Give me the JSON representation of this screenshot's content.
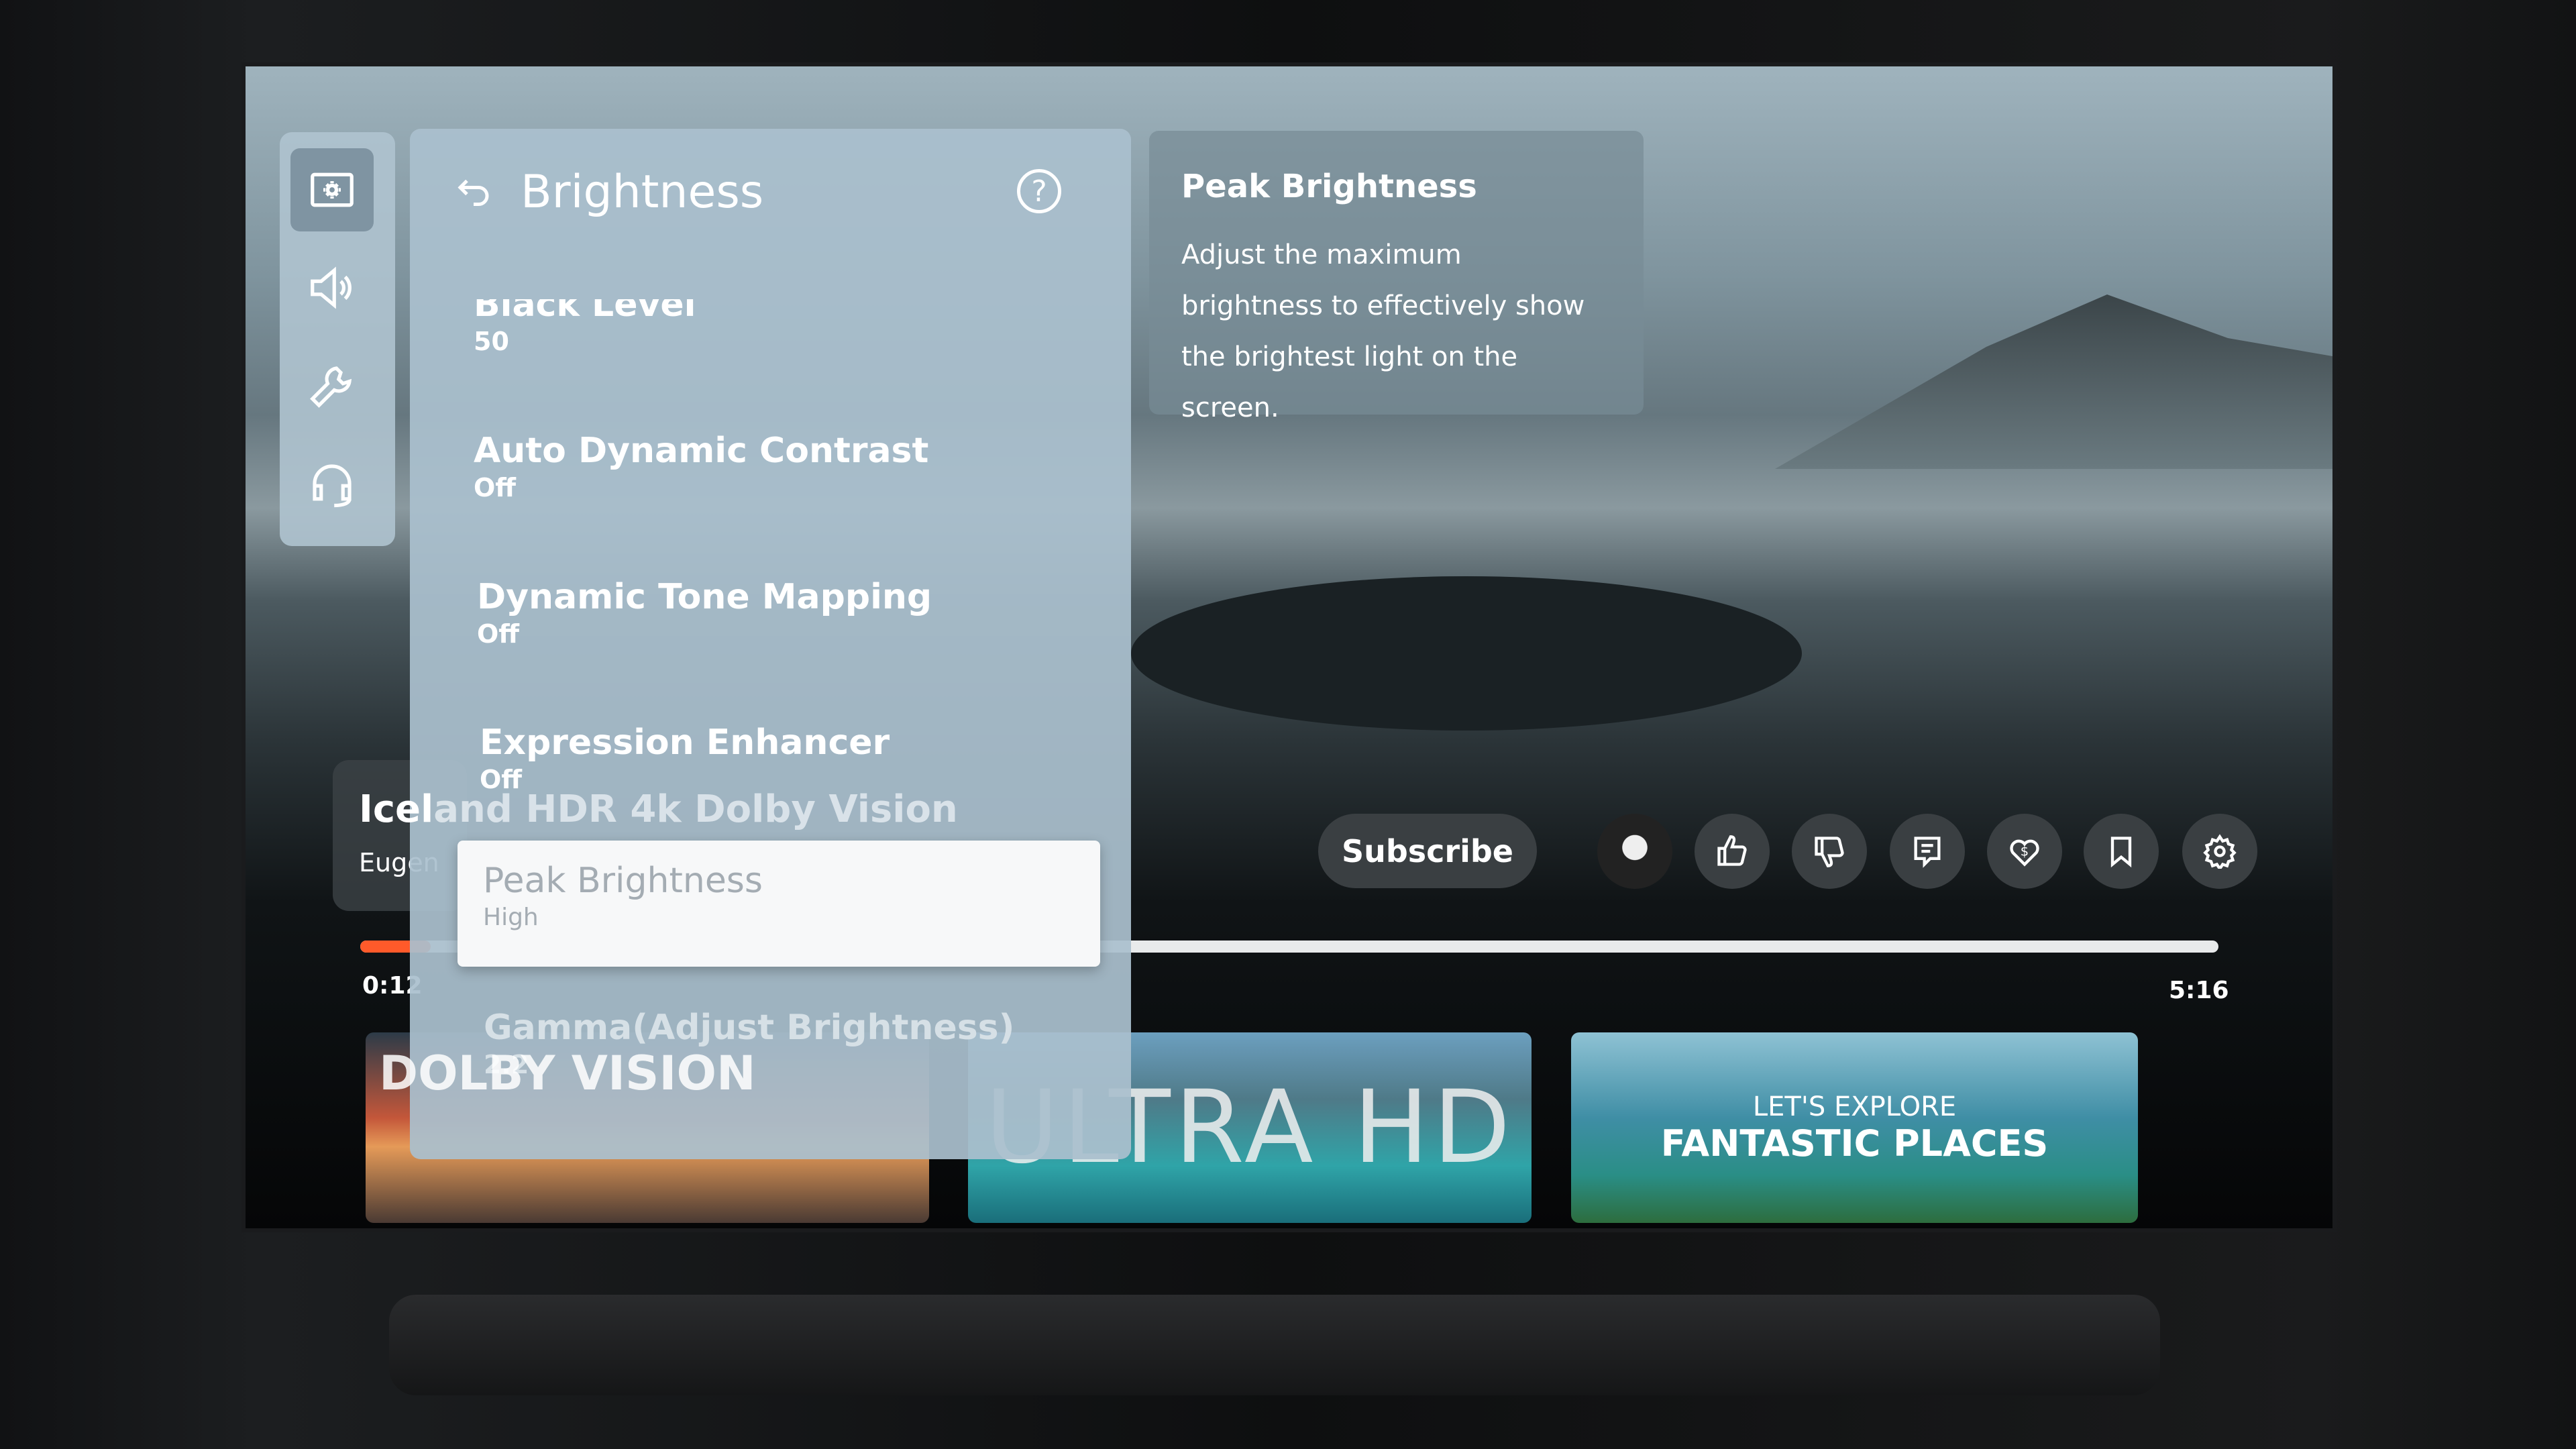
{
  "sidebar": {
    "items": [
      {
        "name": "picture",
        "icon": "picture-brightness-icon",
        "active": true
      },
      {
        "name": "sound",
        "icon": "speaker-icon",
        "active": false
      },
      {
        "name": "general",
        "icon": "wrench-icon",
        "active": false
      },
      {
        "name": "support",
        "icon": "headset-icon",
        "active": false
      }
    ]
  },
  "menu": {
    "title": "Brightness",
    "items": [
      {
        "label": "Black Level",
        "value": "50"
      },
      {
        "label": "Auto Dynamic Contrast",
        "value": "Off"
      },
      {
        "label": "Dynamic Tone Mapping",
        "value": "Off"
      },
      {
        "label": "Expression Enhancer",
        "value": "Off"
      },
      {
        "label": "Peak Brightness",
        "value": "High",
        "selected": true
      },
      {
        "label": "Gamma(Adjust Brightness)",
        "value": "2.2"
      }
    ]
  },
  "info": {
    "title": "Peak Brightness",
    "description": "Adjust the maximum brightness to effectively show the brightest light on the screen."
  },
  "video": {
    "title_lead": "Icel",
    "title_rest": "and HDR 4k Dolby Vision",
    "channel": "Eugen",
    "subscribe": "Subscribe",
    "current_time": "0:12",
    "duration": "5:16",
    "progress_percent": 3.8,
    "accent": "#ff5a2a"
  },
  "thumbnails": [
    {
      "text": "DOLBY VISION"
    },
    {
      "text": "ULTRA HD"
    },
    {
      "text_top": "LET'S EXPLORE",
      "text_main": "FANTASTIC PLACES"
    }
  ]
}
